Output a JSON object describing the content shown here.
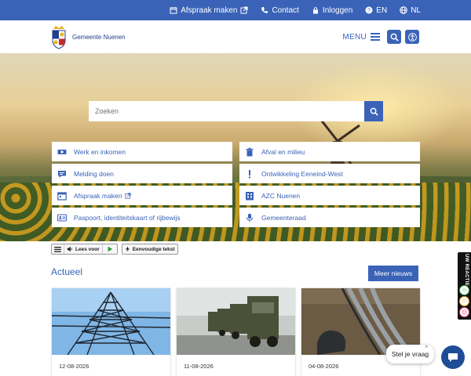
{
  "topbar": {
    "afspraak": "Afspraak maken",
    "contact": "Contact",
    "inloggen": "Inloggen",
    "en": "EN",
    "nl": "NL"
  },
  "header": {
    "logo_prefix": "Gemeente",
    "logo_name": "Nuenen",
    "menu_label": "MENU"
  },
  "search": {
    "placeholder": "Zoeken"
  },
  "tiles": [
    {
      "label": "Werk en inkomen",
      "icon": "money-icon"
    },
    {
      "label": "Afval en milieu",
      "icon": "trash-icon"
    },
    {
      "label": "Melding doen",
      "icon": "chat-icon"
    },
    {
      "label": "Ontwikkeling Eeneind-West",
      "icon": "exclamation-icon"
    },
    {
      "label": "Afspraak maken",
      "icon": "calendar-icon"
    },
    {
      "label": "AZC Nuenen",
      "icon": "building-icon"
    },
    {
      "label": "Paspoort, identiteitskaart of rijbewijs",
      "icon": "id-card-icon"
    },
    {
      "label": "Gemeenteraad",
      "icon": "microphone-icon"
    }
  ],
  "readspeaker": {
    "lees_voor": "Lees voor",
    "eenvoudige": "Eenvoudige tekst"
  },
  "news": {
    "title": "Actueel",
    "more": "Meer nieuws",
    "items": [
      {
        "date": "12-08-2026"
      },
      {
        "date": "11-08-2026"
      },
      {
        "date": "04-08-2026"
      }
    ]
  },
  "feedback": {
    "label": "UW REACTIE"
  },
  "chat": {
    "bubble": "Stel je vraag",
    "close": "×"
  },
  "colors": {
    "primary": "#3a63b8",
    "dark": "#1f4c96"
  }
}
